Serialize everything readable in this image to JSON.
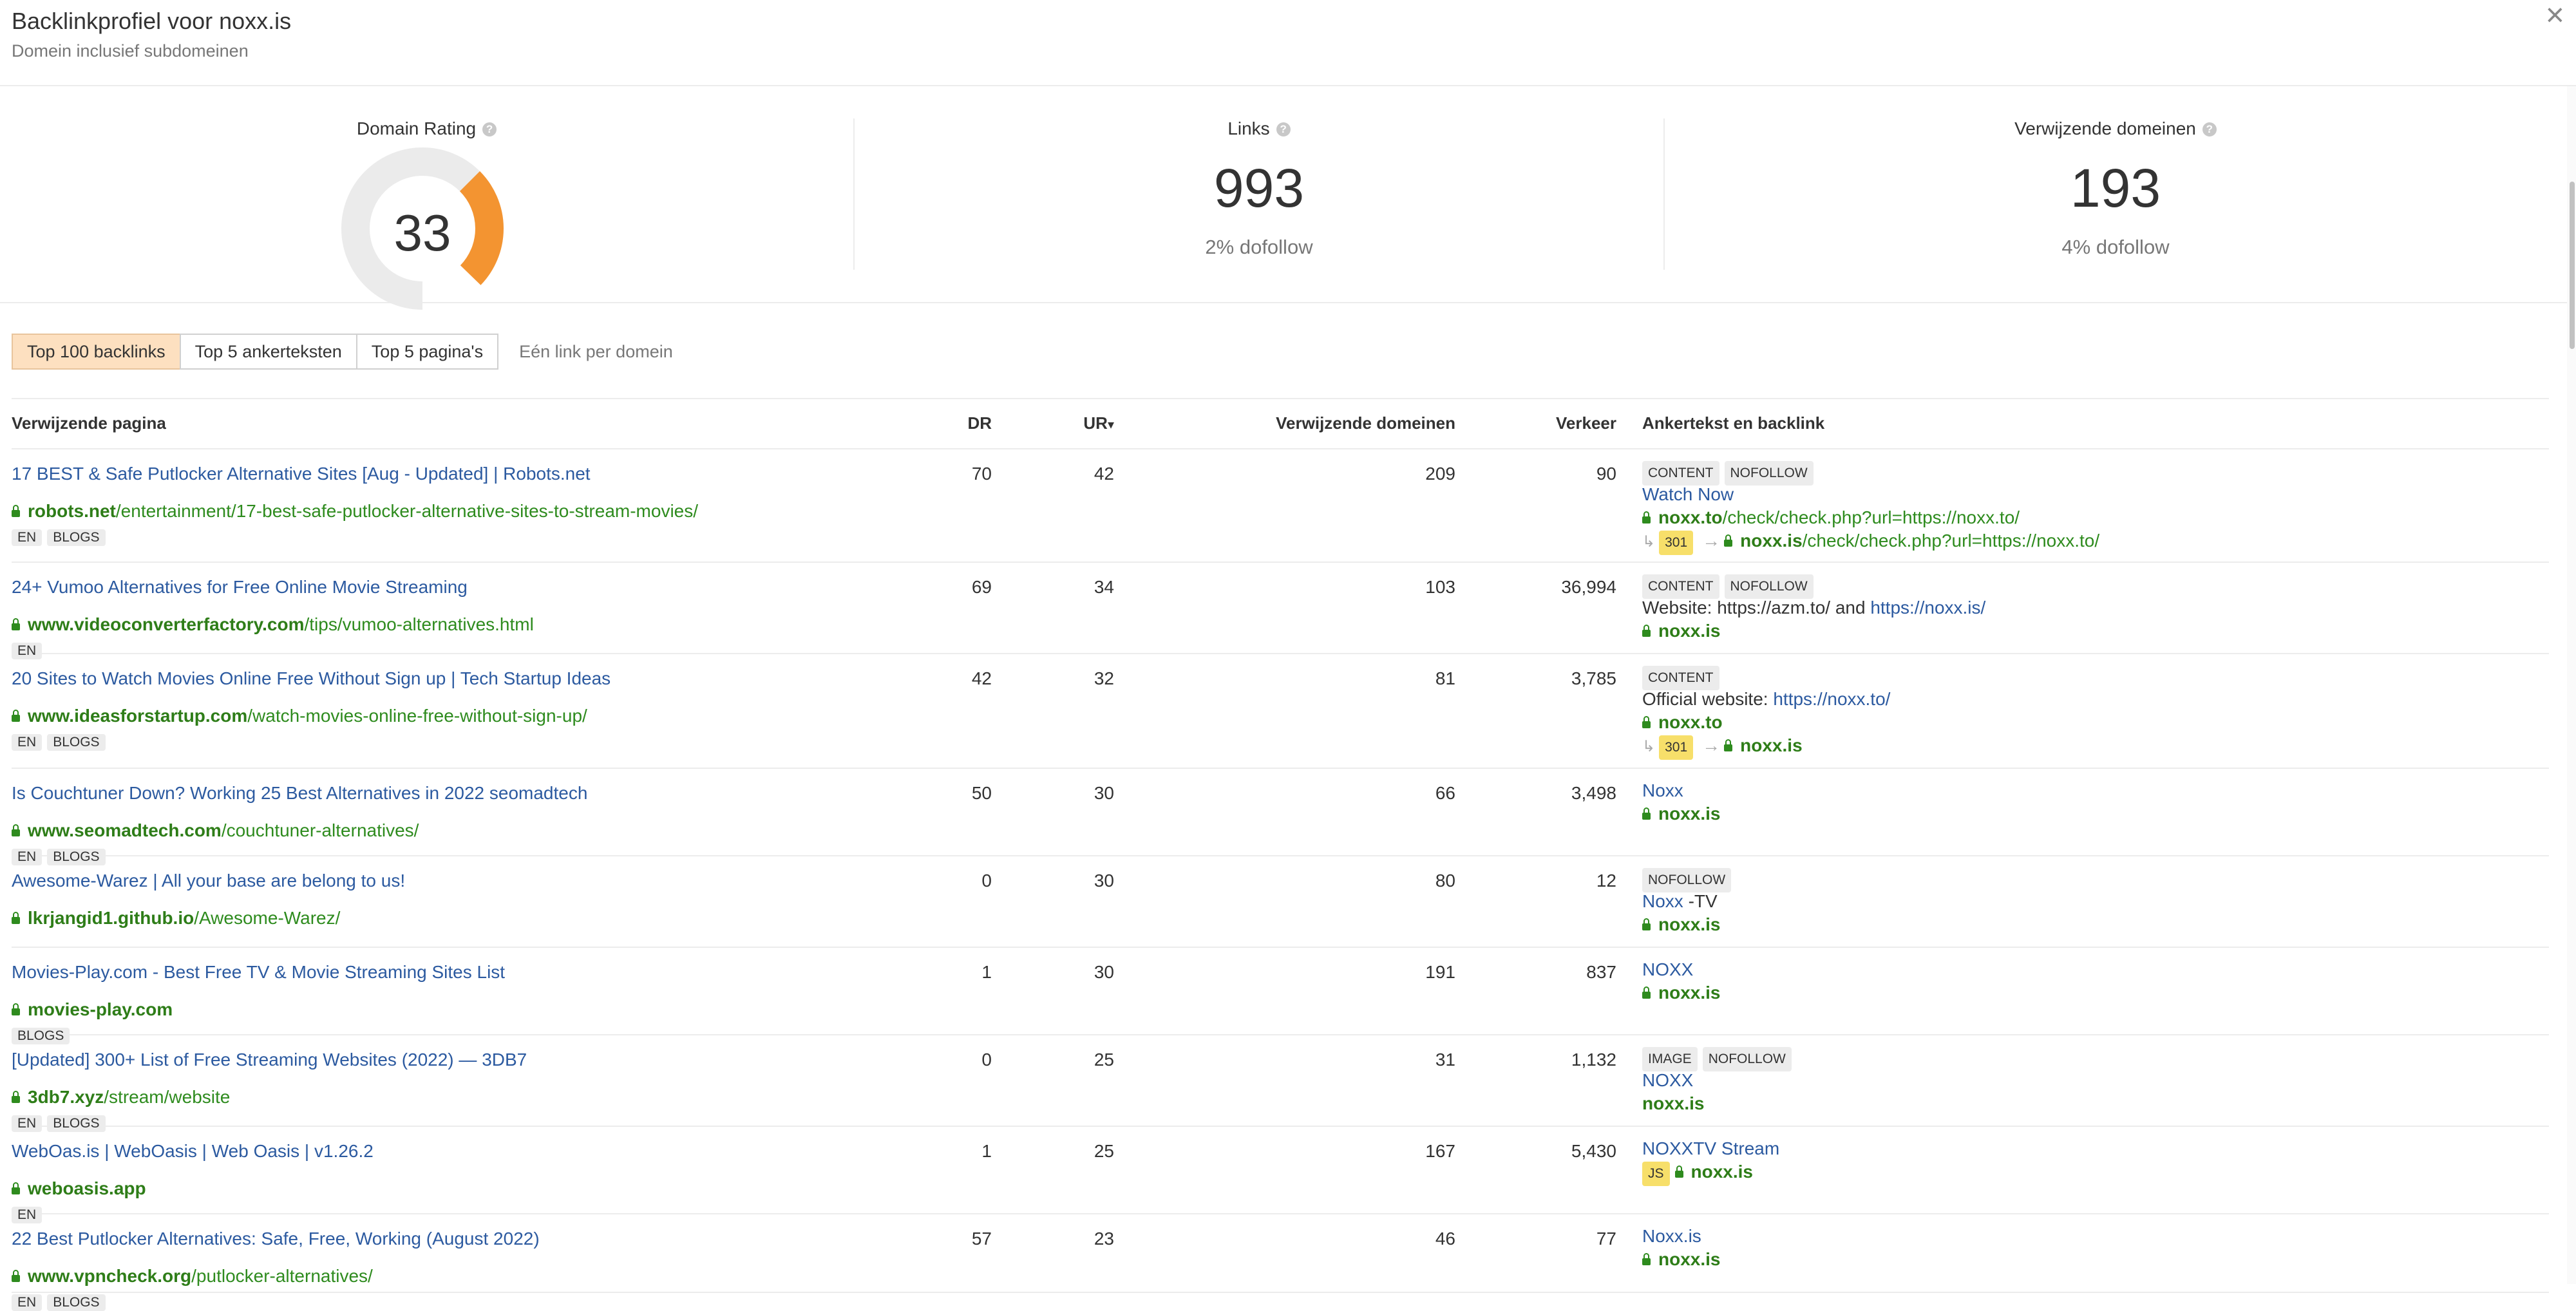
{
  "header": {
    "title": "Backlinkprofiel voor noxx.is",
    "subtitle": "Domein inclusief subdomeinen",
    "close": "×"
  },
  "stats": {
    "domain_rating": {
      "label": "Domain Rating",
      "value": "33",
      "percent": 33,
      "help": "?"
    },
    "links": {
      "label": "Links",
      "value": "993",
      "sub": "2% dofollow",
      "help": "?"
    },
    "referring_domains": {
      "label": "Verwijzende domeinen",
      "value": "193",
      "sub": "4% dofollow",
      "help": "?"
    }
  },
  "colors": {
    "accent": "#f39431",
    "gauge_track": "#ebebeb",
    "link": "#2c5aa0",
    "url": "#2e8b1e",
    "active_tab": "#fde0c0"
  },
  "tabs": [
    {
      "label": "Top 100 backlinks",
      "active": true
    },
    {
      "label": "Top 5 ankerteksten",
      "active": false
    },
    {
      "label": "Top 5 pagina's",
      "active": false
    }
  ],
  "one_link_per_domain": "Eén link per domein",
  "columns": {
    "page": "Verwijzende pagina",
    "dr": "DR",
    "ur": "UR",
    "ur_sort": "▾",
    "ref_domains": "Verwijzende domeinen",
    "traffic": "Verkeer",
    "anchor": "Ankertekst en backlink"
  },
  "rows": [
    {
      "title": "17 BEST & Safe Putlocker Alternative Sites [Aug - Updated] | Robots.net",
      "domain": "robots.net",
      "path": "/entertainment/17-best-safe-putlocker-alternative-sites-to-stream-movies/",
      "tags": [
        "EN",
        "BLOGS"
      ],
      "dr": "70",
      "ur": "42",
      "rd": "209",
      "traffic": "90",
      "badges": [
        "CONTENT",
        "NOFOLLOW"
      ],
      "anchor_link": "Watch Now",
      "target_domain": "noxx.to",
      "target_path": "/check/check.php?url=https://noxx.to/",
      "redirect_code": "301",
      "redirect_domain": "noxx.is",
      "redirect_path": "/check/check.php?url=https://noxx.to/"
    },
    {
      "title": "24+ Vumoo Alternatives for Free Online Movie Streaming",
      "domain": "www.videoconverterfactory.com",
      "path": "/tips/vumoo-alternatives.html",
      "tags": [
        "EN"
      ],
      "dr": "69",
      "ur": "34",
      "rd": "103",
      "traffic": "36,994",
      "badges": [
        "CONTENT",
        "NOFOLLOW"
      ],
      "anchor_text": "Website: https://azm.to/ and ",
      "anchor_link": "https://noxx.is/",
      "target_domain": "noxx.is"
    },
    {
      "title": "20 Sites to Watch Movies Online Free Without Sign up | Tech Startup Ideas",
      "domain": "www.ideasforstartup.com",
      "path": "/watch-movies-online-free-without-sign-up/",
      "tags": [
        "EN",
        "BLOGS"
      ],
      "dr": "42",
      "ur": "32",
      "rd": "81",
      "traffic": "3,785",
      "badges": [
        "CONTENT"
      ],
      "anchor_text": "Official website: ",
      "anchor_link": "https://noxx.to/",
      "target_domain": "noxx.to",
      "redirect_code": "301",
      "redirect_domain": "noxx.is"
    },
    {
      "title": "Is Couchtuner Down? Working 25 Best Alternatives in 2022 seomadtech",
      "domain": "www.seomadtech.com",
      "path": "/couchtuner-alternatives/",
      "tags": [
        "EN",
        "BLOGS"
      ],
      "dr": "50",
      "ur": "30",
      "rd": "66",
      "traffic": "3,498",
      "anchor_link": "Noxx",
      "target_domain": "noxx.is"
    },
    {
      "title": "Awesome-Warez | All your base are belong to us!",
      "domain": "lkrjangid1.github.io",
      "path": "/Awesome-Warez/",
      "tags": [],
      "dr": "0",
      "ur": "30",
      "rd": "80",
      "traffic": "12",
      "badges": [
        "NOFOLLOW"
      ],
      "anchor_link": "Noxx",
      "anchor_suffix": " -TV",
      "target_domain": "noxx.is"
    },
    {
      "title": "Movies-Play.com - Best Free TV & Movie Streaming Sites List",
      "domain": "movies-play.com",
      "path": "",
      "tags": [
        "BLOGS"
      ],
      "dr": "1",
      "ur": "30",
      "rd": "191",
      "traffic": "837",
      "anchor_link": "NOXX",
      "target_domain": "noxx.is"
    },
    {
      "title": "[Updated] 300+ List of Free Streaming Websites (2022) — 3DB7",
      "domain": "3db7.xyz",
      "path": "/stream/website",
      "tags": [
        "EN",
        "BLOGS"
      ],
      "dr": "0",
      "ur": "25",
      "rd": "31",
      "traffic": "1,132",
      "badges": [
        "IMAGE",
        "NOFOLLOW"
      ],
      "anchor_link": " NOXX",
      "target_domain": "noxx.is",
      "target_nolock": true
    },
    {
      "title": "WebOas.is | WebOasis | Web Oasis | v1.26.2",
      "domain": "weboasis.app",
      "path": "",
      "tags": [
        "EN"
      ],
      "dr": "1",
      "ur": "25",
      "rd": "167",
      "traffic": "5,430",
      "anchor_link": "NOXXTV Stream",
      "js_badge": "JS",
      "target_domain": "noxx.is"
    },
    {
      "title": "22 Best Putlocker Alternatives: Safe, Free, Working (August 2022)",
      "domain": "www.vpncheck.org",
      "path": "/putlocker-alternatives/",
      "tags": [
        "EN",
        "BLOGS"
      ],
      "dr": "57",
      "ur": "23",
      "rd": "46",
      "traffic": "77",
      "anchor_link": "Noxx.is",
      "target_domain": "noxx.is"
    }
  ]
}
